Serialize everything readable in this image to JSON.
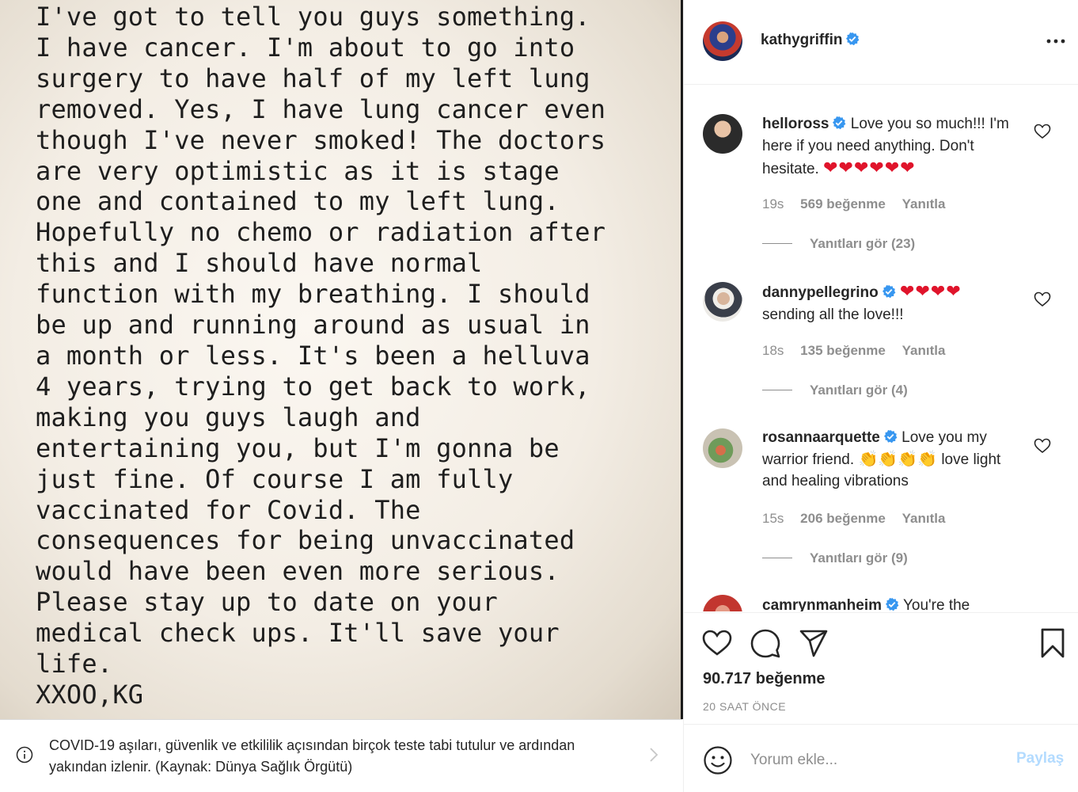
{
  "post_image": {
    "text_lines": [
      "I've got to tell you guys something.",
      "I have cancer. I'm about to go into",
      "surgery to have half of my left lung",
      "removed. Yes, I have lung cancer even",
      "though I've never smoked! The doctors",
      "are very optimistic as it is stage",
      "one and contained to my left lung.",
      "Hopefully no chemo or radiation after",
      "this and I should have normal",
      "function with my breathing. I should",
      "be up and running around as usual in",
      "a month or less. It's been a helluva",
      "4 years, trying to get back to work,",
      "making you guys laugh and",
      "entertaining you, but I'm gonna be",
      "just fine. Of course I am fully",
      "vaccinated for Covid. The",
      "consequences for being unvaccinated",
      "would have been even more serious.",
      "Please stay up to date on your",
      "medical check ups. It'll save your",
      "life.",
      "XXOO,KG"
    ]
  },
  "info_bar": {
    "text": "COVID-19 aşıları, güvenlik ve etkililik açısından birçok teste tabi tutulur ve ardından yakından izlenir. (Kaynak: Dünya Sağlık Örgütü)",
    "icon": "info-icon"
  },
  "header": {
    "username": "kathygriffin",
    "verified": true
  },
  "comments": [
    {
      "username": "helloross",
      "text": "Love you so much!!! I'm here if you need anything. Don't hesitate.",
      "emoji": "❤❤❤❤❤❤",
      "time": "19s",
      "likes": "569 beğenme",
      "reply": "Yanıtla",
      "view_replies": "Yanıtları gör (23)"
    },
    {
      "username": "dannypellegrino",
      "text": "sending all the love!!!",
      "emoji": "❤❤❤❤",
      "time": "18s",
      "likes": "135 beğenme",
      "reply": "Yanıtla",
      "view_replies": "Yanıtları gör (4)"
    },
    {
      "username": "rosannaarquette",
      "text_before": "Love you my warrior friend.",
      "emoji": "👏👏👏👏",
      "text_after": "love light and healing vibrations",
      "time": "15s",
      "likes": "206 beğenme",
      "reply": "Yanıtla",
      "view_replies": "Yanıtları gör (9)"
    },
    {
      "username": "camrynmanheim",
      "text": "You're the"
    }
  ],
  "actions": {
    "likes": "90.717 beğenme",
    "time": "20 SAAT ÖNCE"
  },
  "comment_box": {
    "placeholder": "Yorum ekle...",
    "share_label": "Paylaş"
  },
  "colors": {
    "accent_blue": "#0095f6",
    "verified_blue": "#3897f0",
    "heart_red": "#e0142b",
    "muted_gray": "#8e8e8e",
    "disabled_blue": "#b3dbff"
  }
}
